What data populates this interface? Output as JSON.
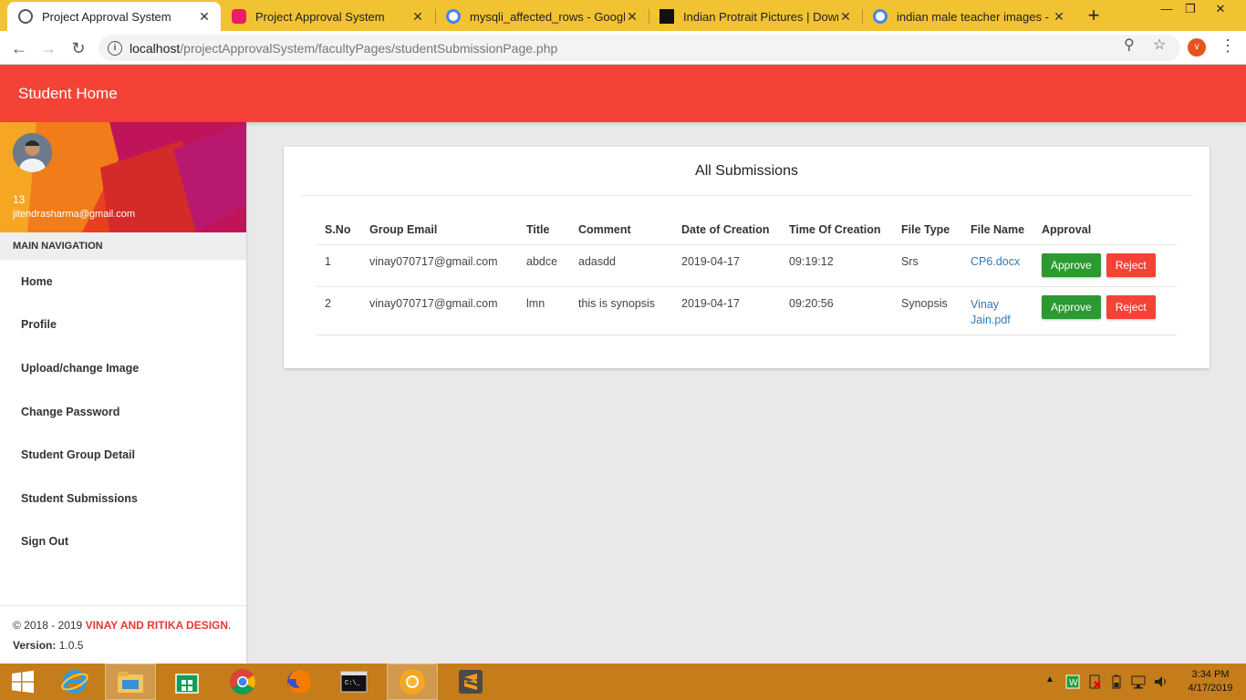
{
  "browser": {
    "tabs": [
      {
        "title": "Project Approval System",
        "active": true,
        "favicon": "globe-icon"
      },
      {
        "title": "Project Approval System",
        "active": false,
        "favicon": "app-icon"
      },
      {
        "title": "mysqli_affected_rows - Google S",
        "active": false,
        "favicon": "google-icon"
      },
      {
        "title": "Indian Protrait Pictures | Downlo",
        "active": false,
        "favicon": "unsplash-icon"
      },
      {
        "title": "indian male teacher images - Go",
        "active": false,
        "favicon": "google-icon"
      }
    ],
    "url_host": "localhost",
    "url_path": "/projectApprovalSystem/facultyPages/studentSubmissionPage.php",
    "profile_initial": "v"
  },
  "header": {
    "title": "Student Home"
  },
  "sidebar": {
    "user_id": "13",
    "user_email": "jitendrasharma@gmail.com",
    "nav_header": "MAIN NAVIGATION",
    "items": [
      {
        "label": "Home"
      },
      {
        "label": "Profile"
      },
      {
        "label": "Upload/change Image"
      },
      {
        "label": "Change Password"
      },
      {
        "label": "Student Group Detail"
      },
      {
        "label": "Student Submissions"
      },
      {
        "label": "Sign Out"
      }
    ],
    "footer": {
      "copyright": "© 2018 - 2019 ",
      "brand": "VINAY AND RITIKA DESIGN",
      "brand_suffix": ".",
      "version_label": "Version:",
      "version": " 1.0.5"
    }
  },
  "main": {
    "title": "All Submissions",
    "columns": [
      "S.No",
      "Group Email",
      "Title",
      "Comment",
      "Date of Creation",
      "Time Of Creation",
      "File Type",
      "File Name",
      "Approval"
    ],
    "rows": [
      {
        "sno": "1",
        "email": "vinay070717@gmail.com",
        "title": "abdce",
        "comment": "adasdd",
        "date": "2019-04-17",
        "time": "09:19:12",
        "file_type": "Srs",
        "file_name": "CP6.docx"
      },
      {
        "sno": "2",
        "email": "vinay070717@gmail.com",
        "title": "lmn",
        "comment": "this is synopsis",
        "date": "2019-04-17",
        "time": "09:20:56",
        "file_type": "Synopsis",
        "file_name": "Vinay Jain.pdf"
      }
    ],
    "approve_label": "Approve",
    "reject_label": "Reject"
  },
  "taskbar": {
    "time": "3:34 PM",
    "date": "4/17/2019"
  },
  "colors": {
    "header": "#f44336",
    "approve": "#2b9a32",
    "reject": "#f44336",
    "link": "#337ab7",
    "brand": "#e53935",
    "tabstrip": "#f1c232",
    "taskbar": "#c47d1a"
  }
}
